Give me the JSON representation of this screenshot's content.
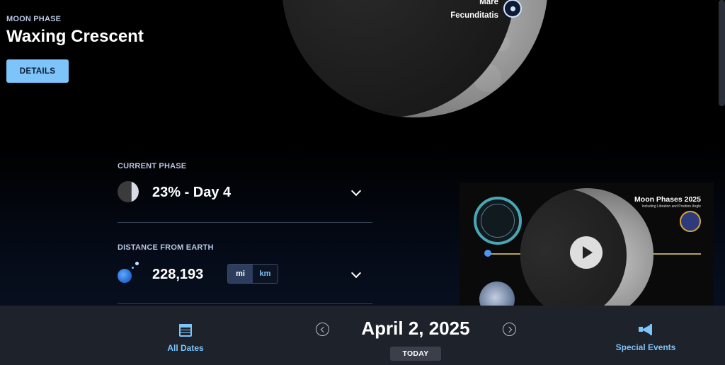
{
  "header": {
    "eyebrow": "MOON PHASE",
    "phase_name": "Waxing Crescent",
    "details_label": "DETAILS"
  },
  "map": {
    "feature_label_line1": "Mare",
    "feature_label_line2": "Fecunditatis"
  },
  "current_phase": {
    "label": "CURRENT PHASE",
    "value": "23% - Day 4",
    "illumination_percent": 23
  },
  "distance": {
    "label": "DISTANCE FROM EARTH",
    "value": "228,193",
    "unit_mi": "mi",
    "unit_km": "km",
    "selected_unit": "mi"
  },
  "video": {
    "title": "Moon Phases 2025",
    "subtitle": "Including Libration and Position Angle"
  },
  "bottom_bar": {
    "all_dates_label": "All Dates",
    "date": "April 2, 2025",
    "today_label": "TODAY",
    "special_events_label": "Special Events"
  },
  "colors": {
    "accent": "#7cc4fa",
    "background": "#000000",
    "bottom_bar": "#1e222b"
  }
}
